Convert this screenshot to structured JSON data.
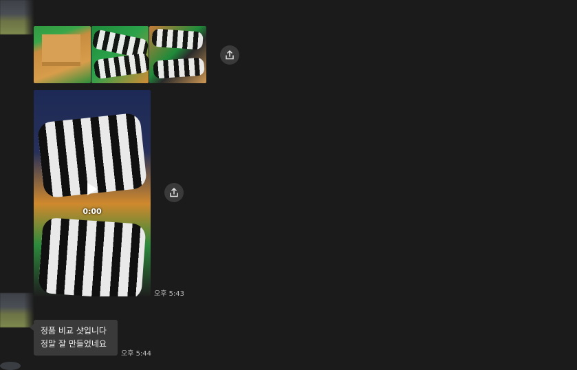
{
  "messages": {
    "video": {
      "duration": "0:00",
      "time": "오후 5:43"
    },
    "text": {
      "lines": [
        "정품 비교 샷입니다",
        "정말 잘 만들었네요"
      ],
      "time": "오후 5:44"
    }
  },
  "icons": {
    "share": "share-icon",
    "play": "play-icon"
  },
  "colors": {
    "background": "#1b1b1b",
    "bubble": "#3a3a3a"
  }
}
